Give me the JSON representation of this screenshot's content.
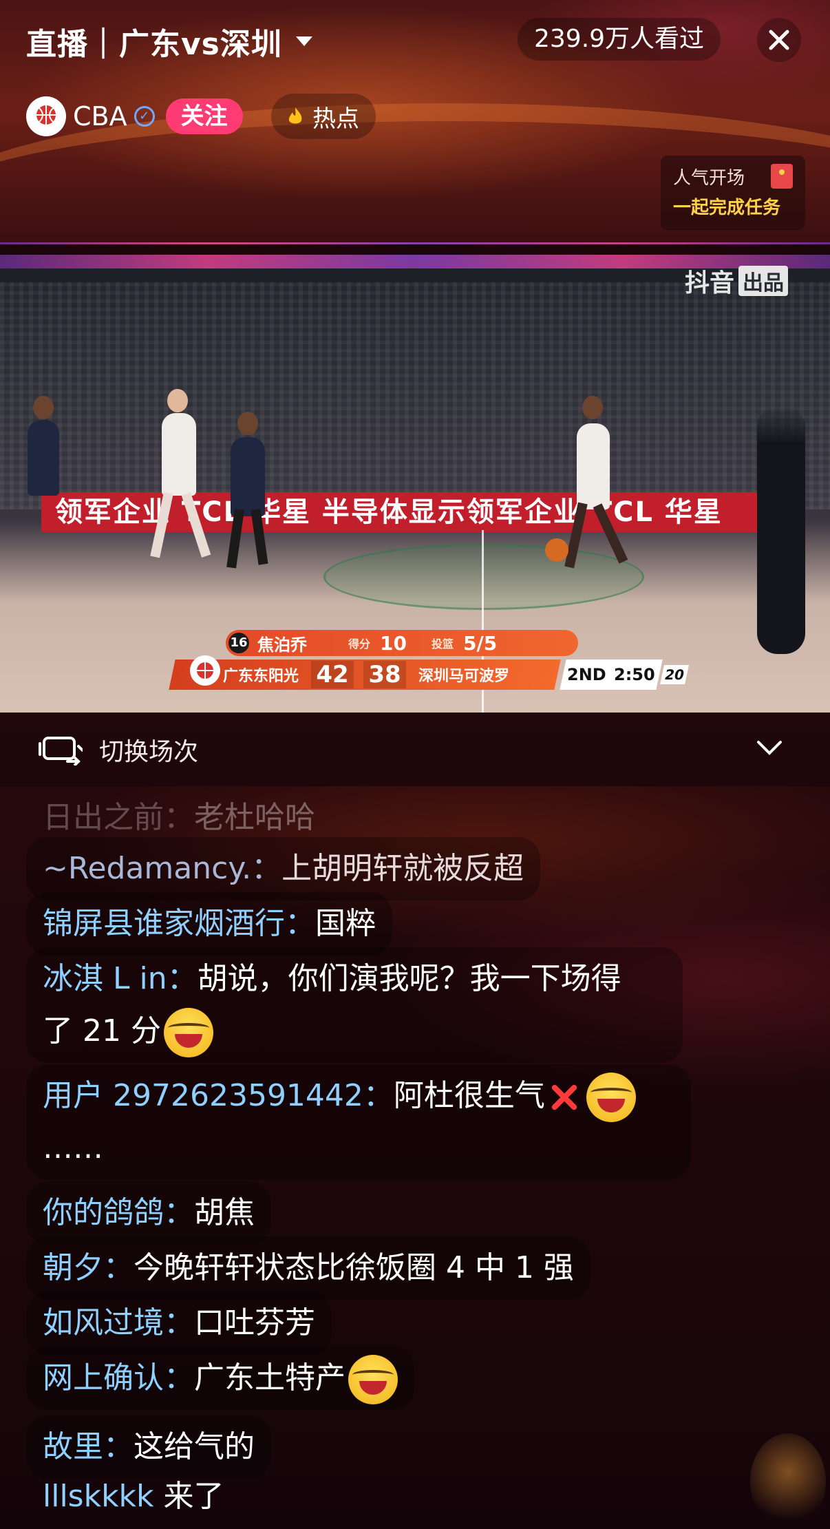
{
  "header": {
    "title": "直播｜广东vs深圳",
    "viewers": "239.9万人看过",
    "host_name": "CBA",
    "follow_label": "关注",
    "hot_label": "热点",
    "task_line1": "人气开场",
    "task_line2": "一起完成任务"
  },
  "video": {
    "watermark_main": "抖音",
    "watermark_tag": "出品",
    "banner_text": "领军企业 TCL 华星 半导体显示领军企业 TCL 华星",
    "scoreboard": {
      "player_number": "16",
      "player_name": "焦泊乔",
      "points_caption": "得分",
      "points": "10",
      "fg_caption": "投篮",
      "fg": "5/5",
      "home_team": "广东东阳光",
      "home_score": "42",
      "away_score": "38",
      "away_team": "深圳马可波罗",
      "quarter": "2ND",
      "clock": "2:50",
      "shot_clock": "20"
    }
  },
  "switch_bar": {
    "label": "切换场次"
  },
  "chat": {
    "messages": [
      {
        "name": "日出之前：",
        "text": "老杜哈哈"
      },
      {
        "name": "~Redamancy.：",
        "text": "上胡明轩就被反超"
      },
      {
        "name": "锦屏县谁家烟酒行：",
        "text": "国粹"
      },
      {
        "name": "冰淇 L in：",
        "text": "胡说，你们演我呢？我一下场得",
        "text2": "了 21 分"
      },
      {
        "name": "用户 2972623591442：",
        "text": "阿杜很生气",
        "text2": "……"
      },
      {
        "name": "你的鸽鸽：",
        "text": "胡焦"
      },
      {
        "name": "朝夕：",
        "text": "今晚轩轩状态比徐饭圈 4 中 1 强"
      },
      {
        "name": "如风过境：",
        "text": "口吐芬芳"
      },
      {
        "name": "网上确认：",
        "text": "广东土特产"
      },
      {
        "name": "故里：",
        "text": "这给气的"
      }
    ],
    "entry": {
      "name": "lllskkkk",
      "text": " 来了"
    }
  },
  "colors": {
    "follow": "#ff3b73",
    "username": "#8fd0ff",
    "scoreboard": "#f0662e"
  }
}
